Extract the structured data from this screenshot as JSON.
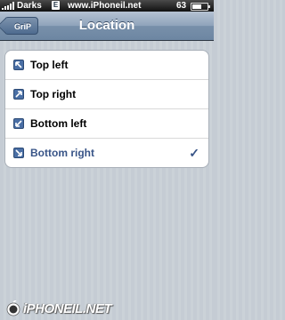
{
  "status_bar": {
    "carrier": "Darks",
    "network_badge": "E",
    "site": "www.iPhoneil.net",
    "battery_level": "63",
    "battery_fraction": 0.63
  },
  "nav": {
    "back_label": "GriP",
    "title": "Location"
  },
  "options": [
    {
      "label": "Top left",
      "icon": "arrow-up-left-icon",
      "selected": false
    },
    {
      "label": "Top right",
      "icon": "arrow-up-right-icon",
      "selected": false
    },
    {
      "label": "Bottom left",
      "icon": "arrow-down-left-icon",
      "selected": false
    },
    {
      "label": "Bottom right",
      "icon": "arrow-down-right-icon",
      "selected": true
    }
  ],
  "checkmark": "✓",
  "colors": {
    "selected_text": "#385487",
    "nav_bar": "#6d86a2",
    "background": "#c5ccd4"
  },
  "watermark": {
    "text": "iPHONEIL.NET"
  }
}
